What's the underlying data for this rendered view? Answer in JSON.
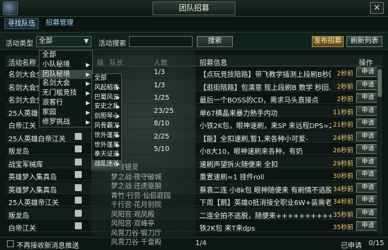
{
  "window": {
    "title": "团队招募",
    "close_glyph": "✕"
  },
  "tabs": [
    {
      "label": "寻找队伍",
      "active": true
    },
    {
      "label": "招募管理",
      "active": false
    }
  ],
  "filter": {
    "activity_type_label": "活动类型",
    "activity_type_value": "全部",
    "activity_search_label": "活动搜索",
    "search_value": "",
    "search_button": "搜索",
    "publish_button": "发布招募",
    "refresh_button": "刷新列表"
  },
  "headers": {
    "name": "活动名称",
    "level": "级",
    "leader": "队长",
    "count": "人数",
    "info": "招募信息",
    "action": "操作"
  },
  "rows": [
    {
      "name": "名剑大会全",
      "count": "1/3",
      "info": "【点玩竞技陪路】带飞教学插测上段刷B秒回",
      "time": "2秒前",
      "action": "申请"
    },
    {
      "name": "名剑大会全",
      "count": "1/3",
      "info": "【逛街陪路】包清意 现上段刷B 数学 秒回…",
      "time": "2秒前",
      "action": "申请"
    },
    {
      "name": "名剑大会全",
      "count": "1/25",
      "info": "最后一个BOSS的CD，需求马头直接点",
      "time": "2秒前",
      "action": "申请"
    },
    {
      "name": "25人英雄帝江关",
      "count": "23/25",
      "info": "单67横晶来暴力熟手内功",
      "time": "11秒前",
      "action": "申请"
    },
    {
      "name": "白帝江关",
      "count": "8/10",
      "info": "小铁2K包，眼神速刷，来SP 来远程DPS=2",
      "time": "21秒前",
      "action": "申请"
    },
    {
      "name": "25人英雄白帝江关",
      "count": "2/25",
      "info": "【能】全扣速刷,暂1,来各种小可爱-",
      "time": "24秒前",
      "action": "申请"
    },
    {
      "name": "叛龙岛",
      "count": "5/10",
      "info": "小8大10，眼神速刷来各种，有奶",
      "time": "26秒前",
      "action": "申请"
    },
    {
      "name": "战宝军械库",
      "count": "",
      "info": "速刷声望拆火随便来 全扣",
      "time": "29秒前",
      "action": "申请"
    },
    {
      "name": "英雄梦入集真岛",
      "count": "",
      "info": "重置速刷=1 挂件roll",
      "time": "30秒前",
      "action": "申请"
    },
    {
      "name": "英雄梦入集真岛",
      "count": "",
      "info": "蔡袁二连 小8k包 眼神随便来 有刷情不逃脱",
      "time": "34秒前",
      "action": "申请"
    },
    {
      "name": "25人英雄帝江关",
      "count": "",
      "info": "下周【鹅】英雄0抵消接全职业6W+装需老…",
      "time": "34秒前",
      "action": "申请"
    },
    {
      "name": "叛龙岛",
      "count": "",
      "info": "二连全拍不逃脱，随便来+++++++++++++",
      "time": "35秒前",
      "action": "申请"
    },
    {
      "name": "白帝江关",
      "count": "",
      "info": "铁2K包 来T来dps",
      "time": "35秒前",
      "action": "申请"
    }
  ],
  "menu": {
    "items": [
      {
        "label": "全部",
        "has_sub": false
      },
      {
        "label": "小队秘境",
        "has_sub": true
      },
      {
        "label": "团队秘境",
        "has_sub": true
      },
      {
        "label": "名剑大会",
        "has_sub": true
      },
      {
        "label": "无门槛竞技",
        "has_sub": true
      },
      {
        "label": "浪客行",
        "has_sub": true
      },
      {
        "label": "家园",
        "has_sub": true
      },
      {
        "label": "修罗挑战",
        "has_sub": true
      }
    ],
    "selected_index": 2
  },
  "submenu": {
    "items": [
      {
        "label": "全部",
        "has_sub": false
      },
      {
        "label": "风起稻香",
        "has_sub": true
      },
      {
        "label": "巴蜀风云",
        "has_sub": true
      },
      {
        "label": "安史之乱",
        "has_sub": true
      },
      {
        "label": "剑胆琴心",
        "has_sub": true
      },
      {
        "label": "风骨霸刀",
        "has_sub": true
      },
      {
        "label": "世外蓬莱",
        "has_sub": true
      },
      {
        "label": "世外蓬莱",
        "has_sub": true
      },
      {
        "label": "奉天证道",
        "has_sub": true
      },
      {
        "label": "战乱迷谷",
        "has_sub": true
      }
    ],
    "selected_index": 9
  },
  "background_list": [
    "一夜银灵",
    "梦之战·夜守破城",
    "梦之战·还虎驱狼",
    "青竹·行宫·仙侣庭园",
    "千行宫·花月别院",
    "风阳宫·观凤殿",
    "风阳宫·双峰亭",
    "风霄刀谷·锻刀厅",
    "风霄刀谷·千雷殿"
  ],
  "footer": {
    "checkbox_label": "不再接收新消息推送",
    "page": "1/4",
    "applied": "已申请",
    "count": "0/15"
  }
}
